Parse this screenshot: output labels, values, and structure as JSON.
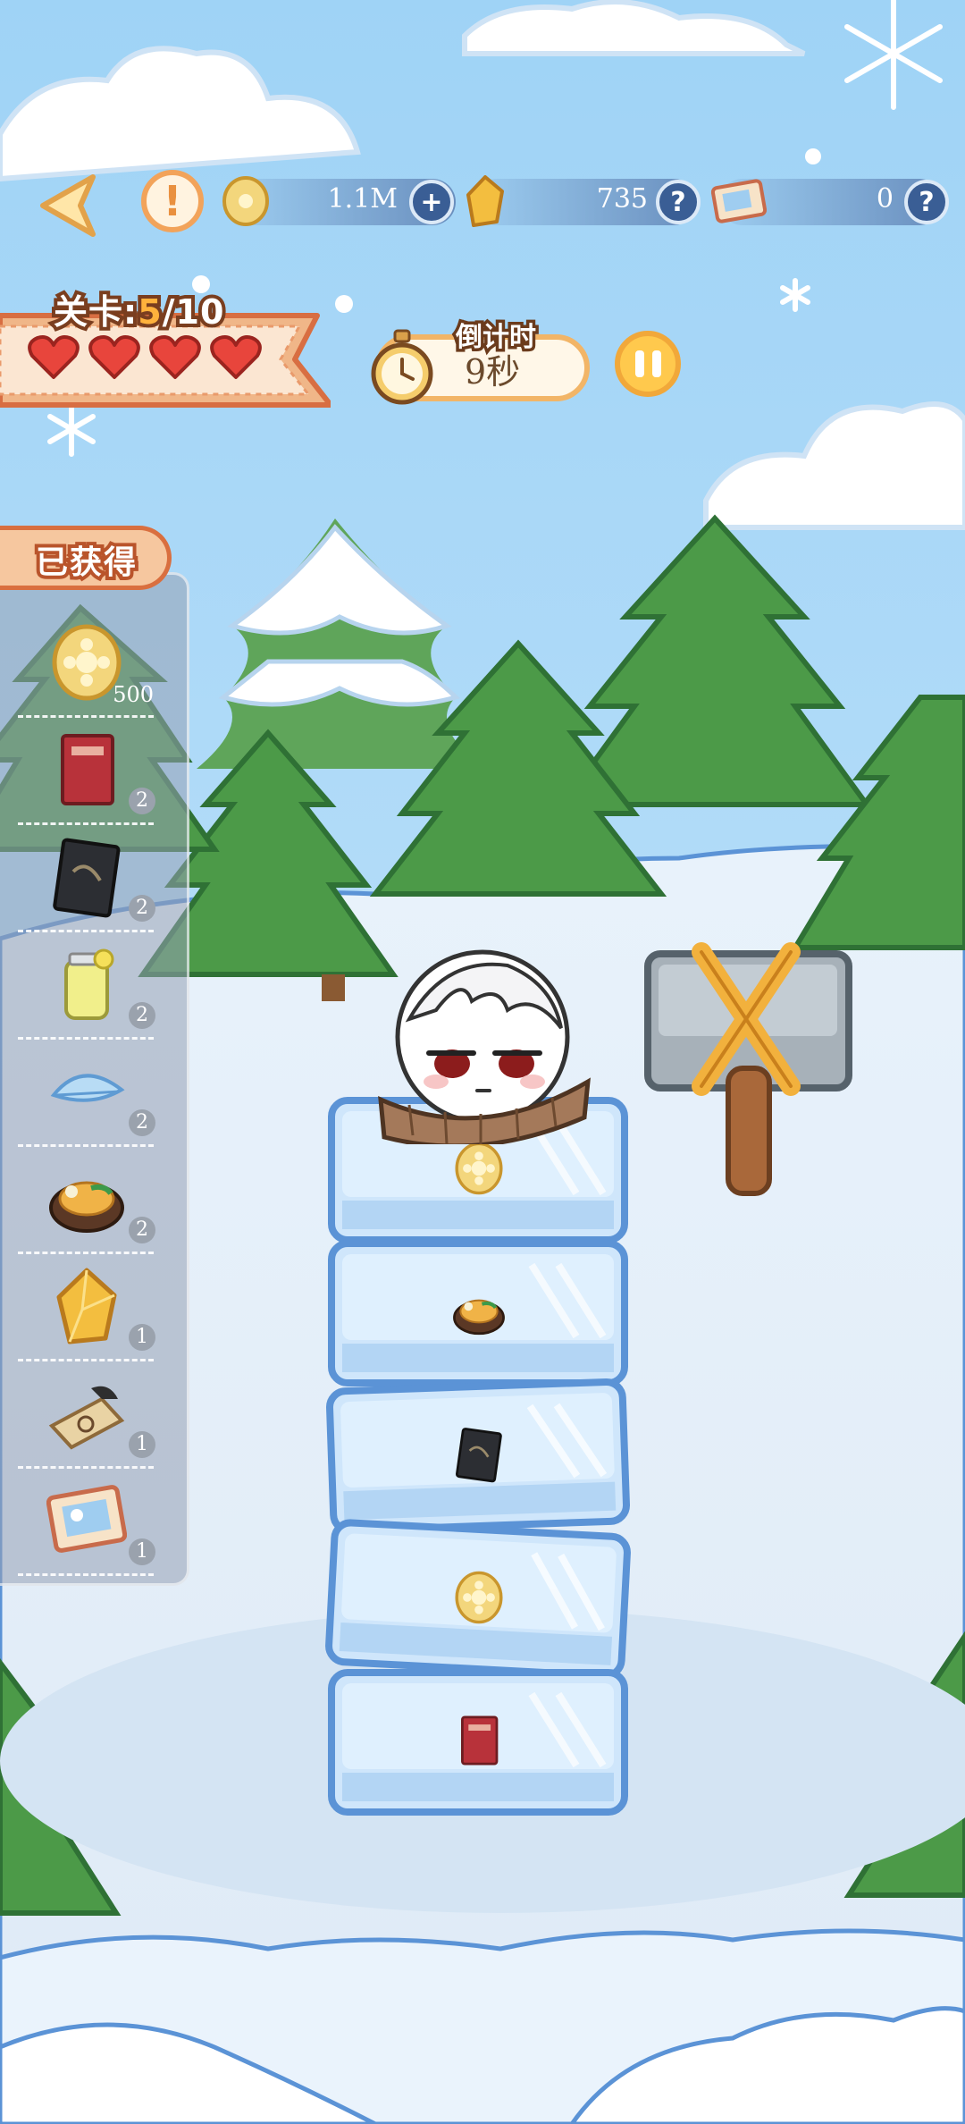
{
  "hud": {
    "coins": "1.1M",
    "gems": "735",
    "tickets": "0",
    "add_symbol": "+",
    "help_symbol": "?",
    "info_symbol": "!"
  },
  "level": {
    "prefix": "关卡:",
    "current": "5",
    "total": "/10",
    "hearts": 4
  },
  "timer": {
    "label": "倒计时",
    "value": "9秒"
  },
  "obtained": {
    "title": "已获得",
    "items": [
      {
        "icon": "gold-coin-icon",
        "count": "500"
      },
      {
        "icon": "red-book-icon",
        "count": "2"
      },
      {
        "icon": "dark-card-icon",
        "count": "2"
      },
      {
        "icon": "lemonade-jar-icon",
        "count": "2"
      },
      {
        "icon": "blue-feather-icon",
        "count": "2"
      },
      {
        "icon": "omelette-rice-icon",
        "count": "2"
      },
      {
        "icon": "amber-gem-icon",
        "count": "1"
      },
      {
        "icon": "map-scroll-icon",
        "count": "1"
      },
      {
        "icon": "photo-ticket-icon",
        "count": "1"
      }
    ]
  },
  "tower": {
    "blocks": [
      "gold-coin-icon",
      "omelette-rice-icon",
      "dark-card-icon",
      "gold-coin-icon",
      "red-book-icon"
    ]
  },
  "colors": {
    "accent_orange": "#f2a35a",
    "heart_red": "#e8453c",
    "ice_blue": "#5b93d6"
  }
}
